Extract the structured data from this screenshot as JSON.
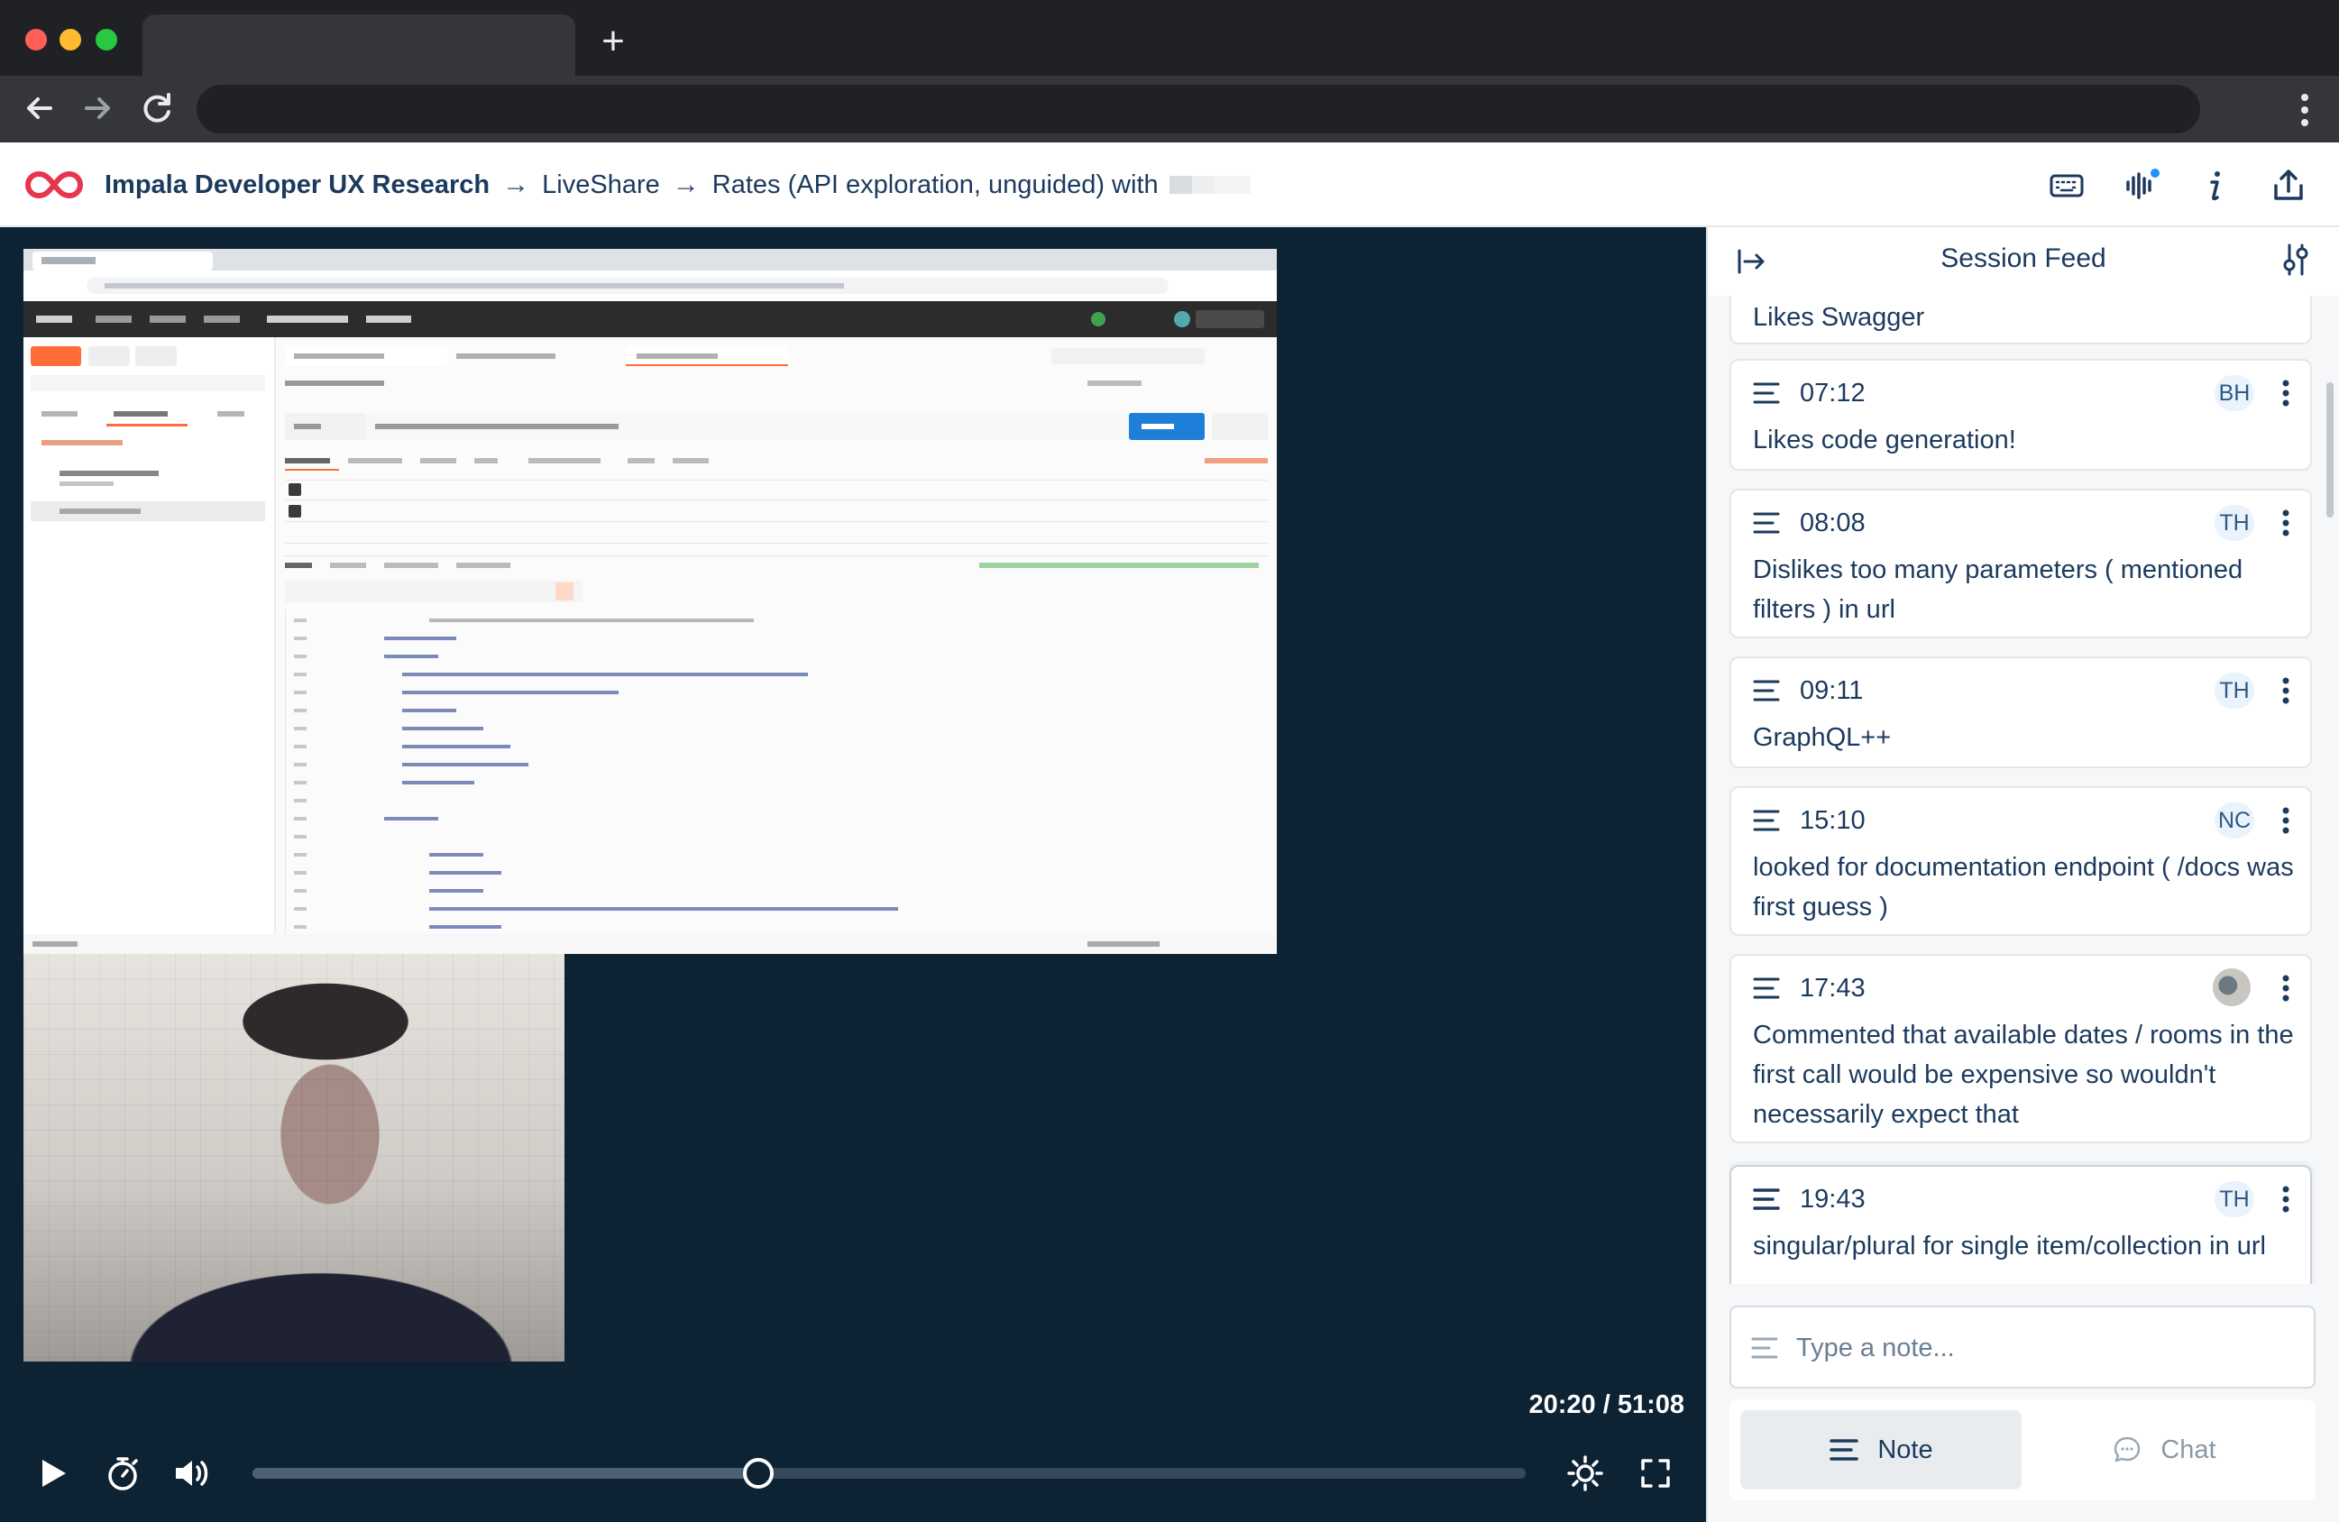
{
  "browser": {
    "new_tab_label": "+",
    "nav": [
      "back",
      "forward",
      "reload"
    ]
  },
  "header": {
    "crumbs": [
      "Impala Developer UX Research",
      "LiveShare",
      "Rates (API exploration, unguided) with"
    ],
    "arrow": "→",
    "icons": [
      "keyboard-icon",
      "audio-waveform-icon",
      "info-icon",
      "share-icon"
    ]
  },
  "player": {
    "time": "20:20 / 51:08",
    "progress": 0.397,
    "icons": [
      "play-icon",
      "timer-icon",
      "volume-icon",
      "brightness-icon",
      "fullscreen-icon"
    ]
  },
  "feed": {
    "title": "Session Feed",
    "partial_top": "Likes Swagger",
    "notes": [
      {
        "time": "07:12",
        "author": "BH",
        "text": "Likes code generation!"
      },
      {
        "time": "08:08",
        "author": "TH",
        "text": "Dislikes too many parameters ( mentioned filters ) in url"
      },
      {
        "time": "09:11",
        "author": "TH",
        "text": "GraphQL++"
      },
      {
        "time": "15:10",
        "author": "NC",
        "text": "looked for documentation endpoint ( /docs was first guess )"
      },
      {
        "time": "17:43",
        "author": "",
        "text": "Commented that available dates / rooms in the first call would be expensive so wouldn't necessarily expect that"
      },
      {
        "time": "19:43",
        "author": "TH",
        "text": "singular/plural for single item/collection in url"
      }
    ],
    "composer_placeholder": "Type a note...",
    "mode_note": "Note",
    "mode_chat": "Chat"
  },
  "colors": {
    "video_bg": "#0d2233",
    "brand_red": "#e8344e",
    "text_navy": "#1c3a5e",
    "accent_blue": "#1e90ff"
  }
}
